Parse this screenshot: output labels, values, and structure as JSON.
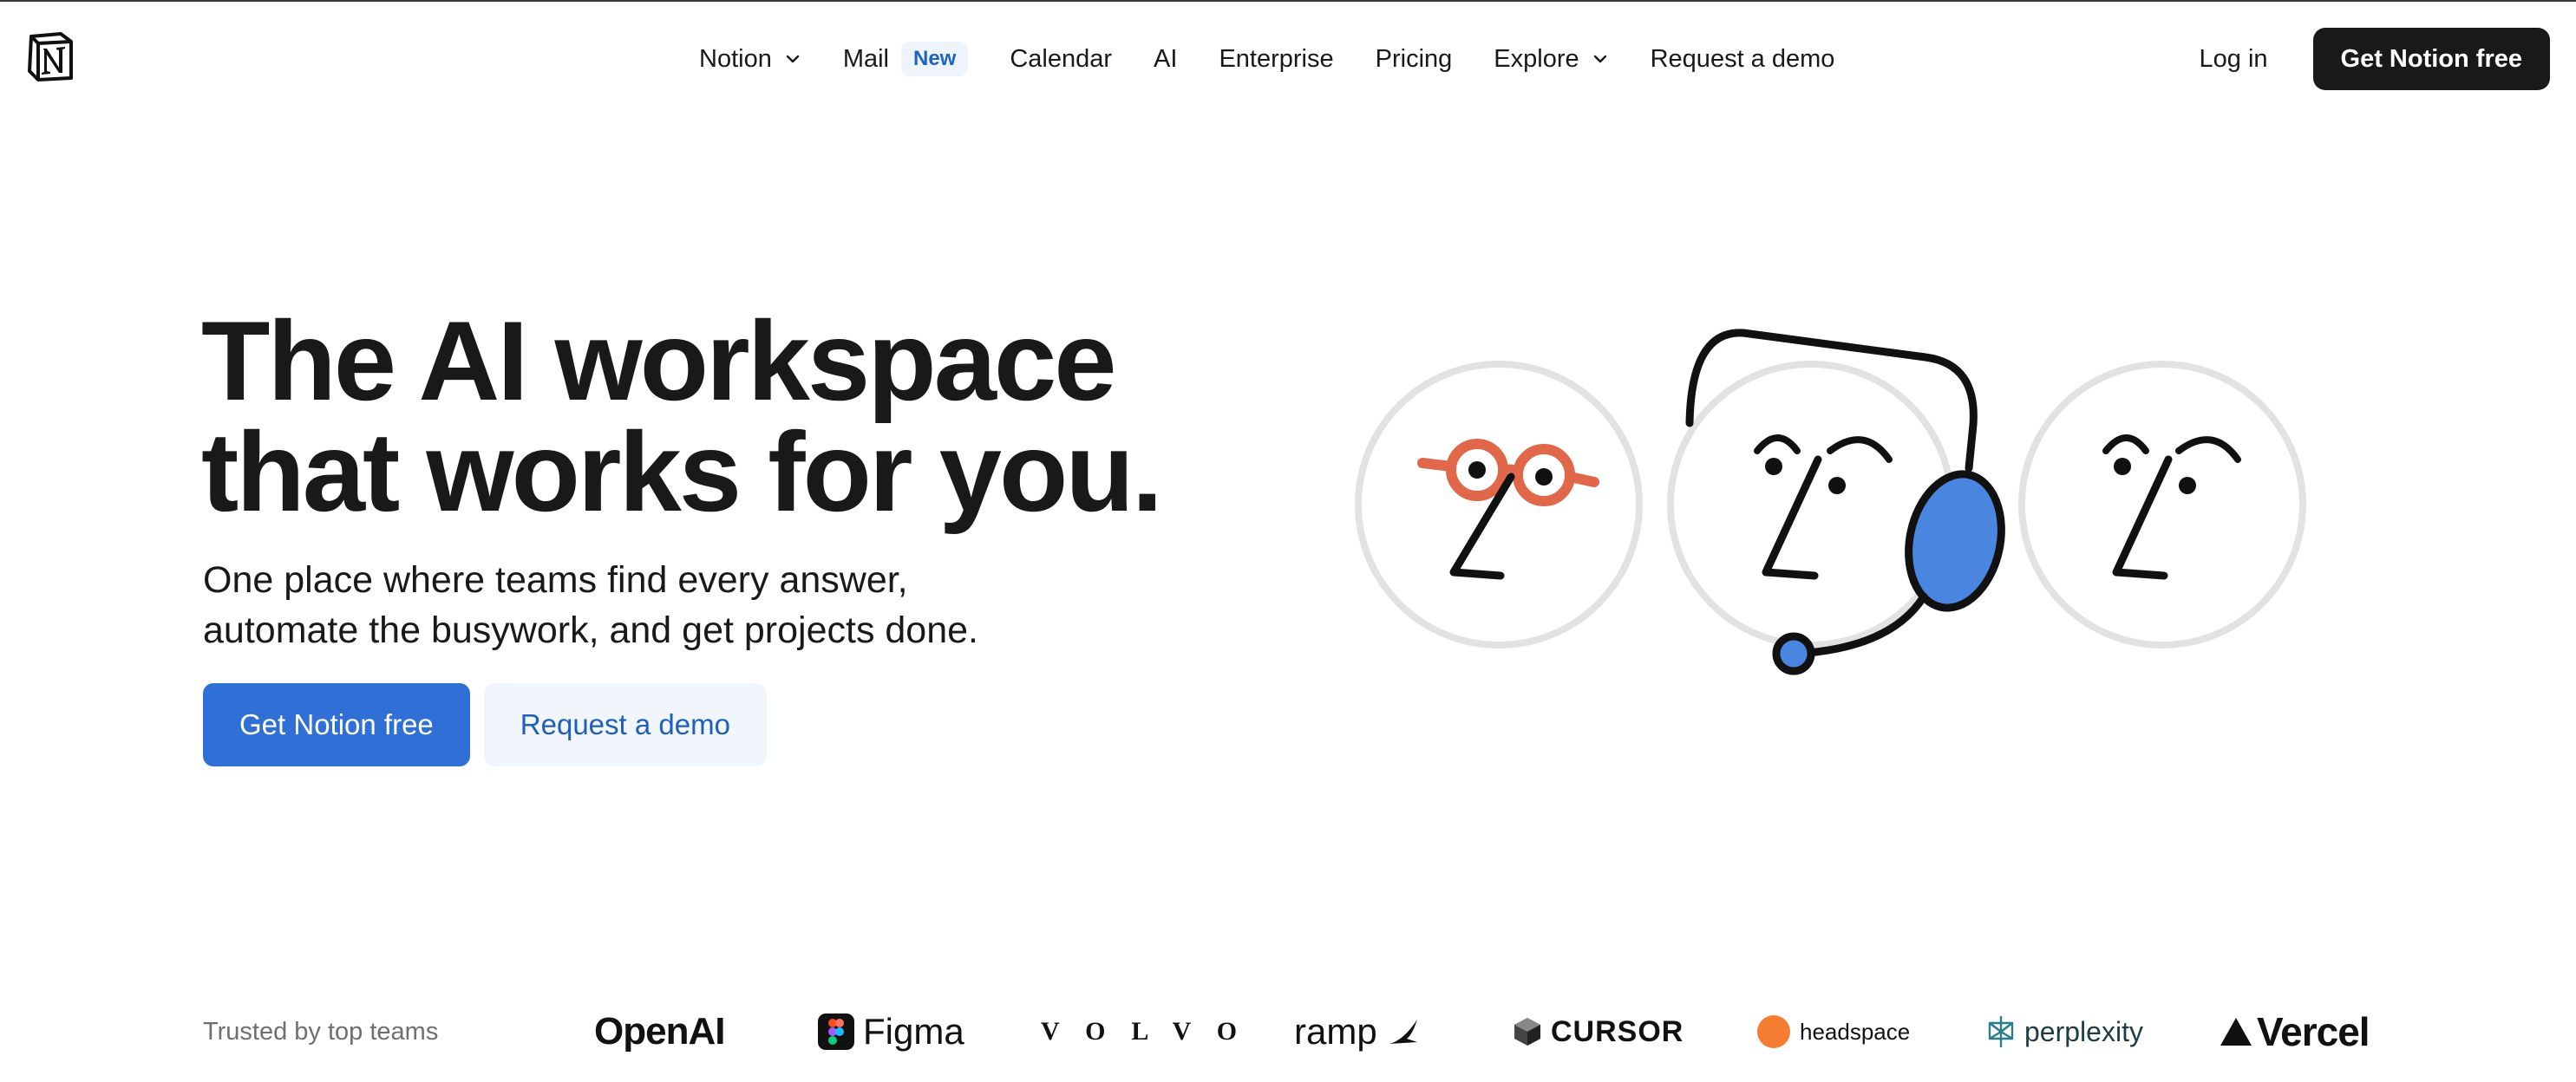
{
  "nav": {
    "logo_text": "N",
    "items": [
      {
        "label": "Notion",
        "has_dropdown": true
      },
      {
        "label": "Mail",
        "badge": "New"
      },
      {
        "label": "Calendar"
      },
      {
        "label": "AI"
      },
      {
        "label": "Enterprise"
      },
      {
        "label": "Pricing"
      },
      {
        "label": "Explore",
        "has_dropdown": true
      },
      {
        "label": "Request a demo"
      }
    ],
    "login_label": "Log in",
    "cta_label": "Get Notion free"
  },
  "hero": {
    "title_line1": "The AI workspace",
    "title_line2": "that works for you.",
    "subtitle_line1": "One place where teams find every answer,",
    "subtitle_line2": "automate the busywork, and get projects done.",
    "primary_cta": "Get Notion free",
    "secondary_cta": "Request a demo"
  },
  "trusted": {
    "label": "Trusted by top teams",
    "brands": [
      "OpenAI",
      "Figma",
      "VOLVO",
      "ramp",
      "CURSOR",
      "headspace",
      "perplexity",
      "Vercel"
    ]
  },
  "colors": {
    "primary_blue": "#2f6fd6",
    "dark_button": "#191919",
    "glasses_orange": "#e0674a",
    "headset_blue": "#4a86e0",
    "headspace_orange": "#f47d31"
  },
  "icons": [
    "notion-logo-icon",
    "chevron-down-icon",
    "face-illustration-glasses",
    "face-illustration-headset",
    "face-illustration-plain"
  ]
}
